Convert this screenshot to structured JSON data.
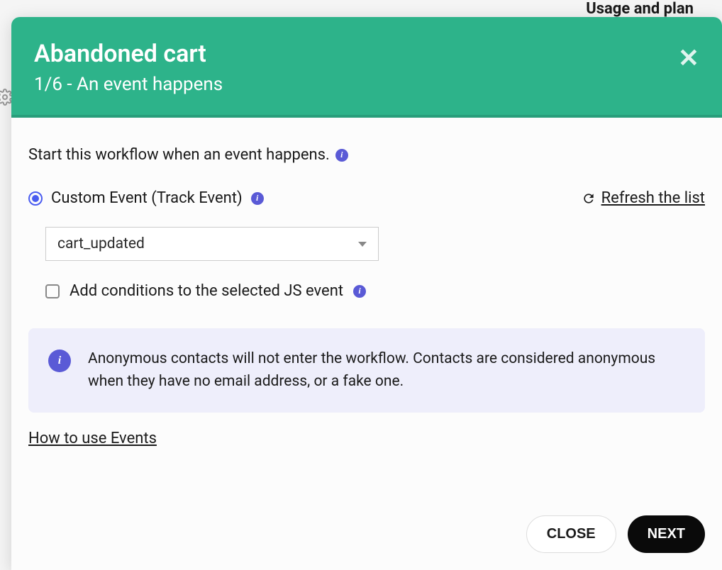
{
  "background": {
    "usage_label": "Usage and plan"
  },
  "modal": {
    "title": "Abandoned cart",
    "subtitle": "1/6 - An event happens",
    "intro": "Start this workflow when an event happens.",
    "radio_label": "Custom Event (Track Event)",
    "refresh_label": "Refresh the list",
    "selected_event": "cart_updated",
    "checkbox_label": "Add conditions to the selected JS event",
    "info_text": "Anonymous contacts will not enter the workflow. Contacts are considered anonymous when they have no email address, or a fake one.",
    "help_link": "How to use Events",
    "close_button": "CLOSE",
    "next_button": "NEXT"
  }
}
